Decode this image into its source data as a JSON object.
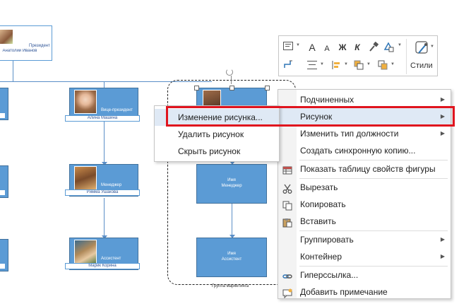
{
  "orgchart": {
    "top": {
      "role": "Президент",
      "name": "Анатолий Иванов"
    },
    "vp": {
      "role": "Вице-президент",
      "name": "Алина Машина"
    },
    "manager": {
      "role": "Менеджер",
      "name": "Римма Ушакова"
    },
    "assistant": {
      "role": "Ассистент",
      "name": "Марик Корина"
    },
    "placeholder_manager": {
      "line1": "Имя",
      "line2": "Менеджер"
    },
    "placeholder_assistant": {
      "line1": "Имя",
      "line2": "Ассистент"
    },
    "group_label": "Группа маркетинга"
  },
  "toolbar": {
    "styles_label": "Стили",
    "font_increase": "A",
    "font_decrease": "A",
    "bold": "Ж",
    "italic": "К"
  },
  "submenu": {
    "items": [
      {
        "label": "Изменение рисунка..."
      },
      {
        "label": "Удалить рисунок"
      },
      {
        "label": "Скрыть рисунок"
      }
    ]
  },
  "context_menu": {
    "items": [
      {
        "label": "Подчиненных",
        "has_submenu": true,
        "icon": ""
      },
      {
        "label": "Рисунок",
        "has_submenu": true,
        "icon": "",
        "highlighted": true
      },
      {
        "label": "Изменить тип должности",
        "has_submenu": true,
        "icon": ""
      },
      {
        "label": "Создать синхронную копию...",
        "has_submenu": false,
        "icon": ""
      },
      {
        "label": "Показать таблицу свойств фигуры",
        "has_submenu": false,
        "icon": "table-icon"
      },
      {
        "label": "Вырезать",
        "has_submenu": false,
        "icon": "scissors-icon"
      },
      {
        "label": "Копировать",
        "has_submenu": false,
        "icon": "copy-icon"
      },
      {
        "label": "Вставить",
        "has_submenu": false,
        "icon": "paste-icon"
      },
      {
        "label": "Группировать",
        "has_submenu": true,
        "icon": ""
      },
      {
        "label": "Контейнер",
        "has_submenu": true,
        "icon": ""
      },
      {
        "label": "Гиперссылка...",
        "has_submenu": false,
        "icon": "link-icon"
      },
      {
        "label": "Добавить примечание",
        "has_submenu": false,
        "icon": "comment-icon"
      }
    ]
  },
  "colors": {
    "shape_fill": "#5b9bd5",
    "connector": "#5b8fc7",
    "highlight_border": "#e0141e",
    "menu_hover": "#dfe9f5"
  }
}
